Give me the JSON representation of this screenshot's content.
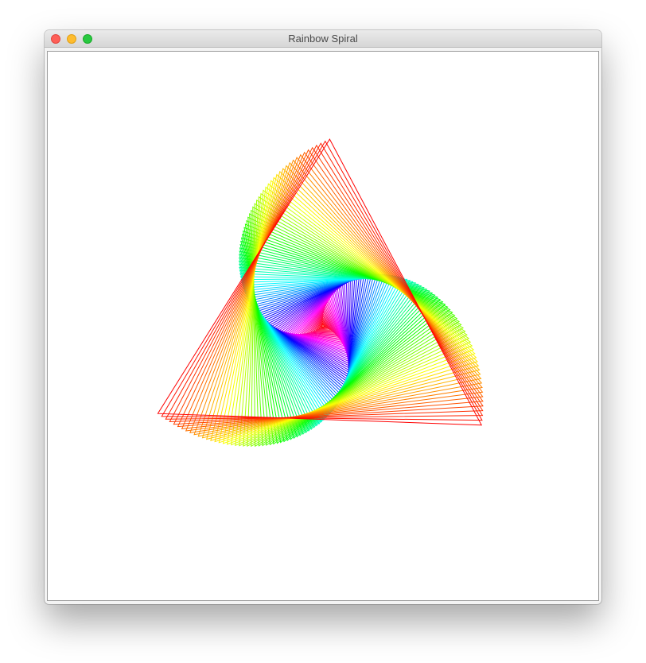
{
  "window": {
    "title": "Rainbow Spiral",
    "controls": [
      "close-icon",
      "minimize-icon",
      "zoom-icon"
    ]
  },
  "colors": {
    "close": "#fe5f57",
    "minimize": "#febc2e",
    "zoom": "#28c840",
    "canvas_background": "#ffffff"
  },
  "drawing": {
    "shape": "triangle",
    "palette": "rainbow"
  }
}
